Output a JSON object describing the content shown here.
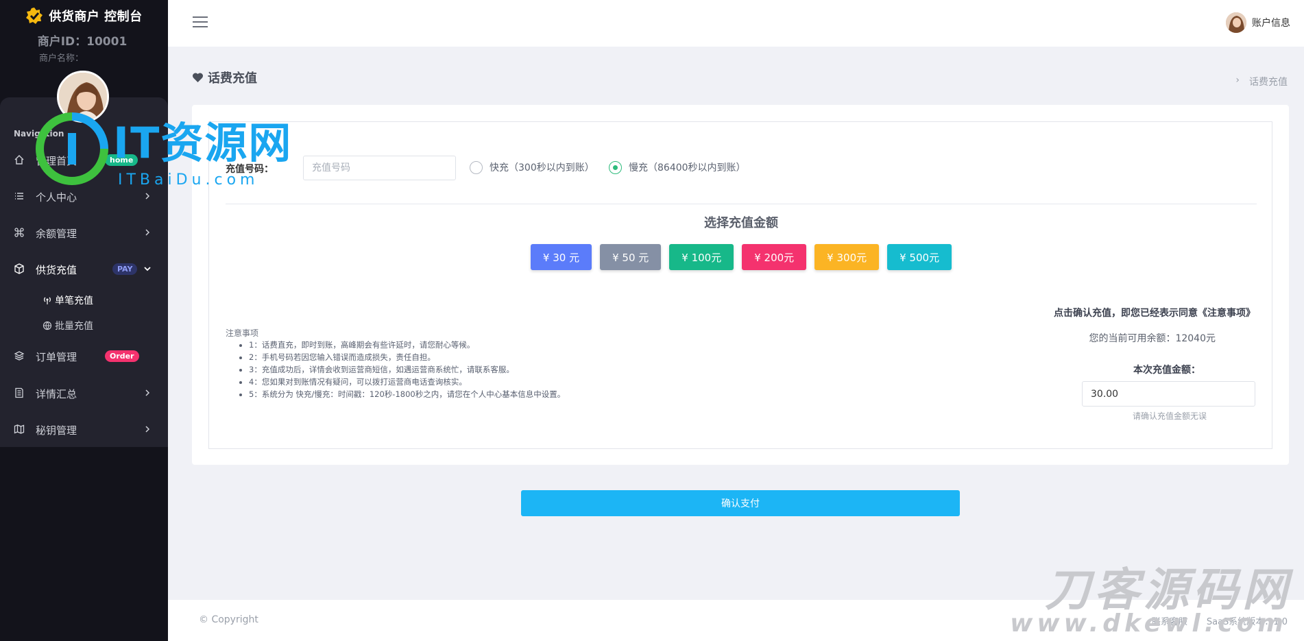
{
  "brand": {
    "title": "供货商户 控制台"
  },
  "merchant": {
    "id_label": "商户ID：10001",
    "name_label": "商户名称："
  },
  "sidebar": {
    "heading": "Navigation",
    "items": [
      {
        "label": "管理首页",
        "icon": "home-icon",
        "badge": "home"
      },
      {
        "label": "个人中心",
        "icon": "list-icon"
      },
      {
        "label": "余额管理",
        "icon": "command-icon"
      },
      {
        "label": "供货充值",
        "icon": "box-icon",
        "badge": "PAY"
      },
      {
        "label": "订单管理",
        "icon": "layers-icon",
        "badge": "Order"
      },
      {
        "label": "详情汇总",
        "icon": "document-icon"
      },
      {
        "label": "秘钥管理",
        "icon": "map-icon"
      }
    ],
    "sub_items": [
      {
        "label": "单笔充值",
        "icon": "broadcast-icon"
      },
      {
        "label": "批量充值",
        "icon": "globe-icon"
      }
    ]
  },
  "header": {
    "account_label": "账户信息"
  },
  "page": {
    "title": "话费充值",
    "breadcrumb": "话费充值"
  },
  "form": {
    "phone_label": "充值号码：",
    "phone_placeholder": "充值号码",
    "radio_fast": "快充（300秒以内到账）",
    "radio_slow": "慢充（86400秒以内到账）",
    "selected_radio": "slow"
  },
  "amount_section": {
    "title": "选择充值金额",
    "buttons": [
      {
        "label": "¥ 30 元",
        "color": "#5b7cfa"
      },
      {
        "label": "¥ 50 元",
        "color": "#8590a5"
      },
      {
        "label": "¥ 100元",
        "color": "#17b889"
      },
      {
        "label": "¥ 200元",
        "color": "#f4326e"
      },
      {
        "label": "¥ 300元",
        "color": "#fbb424"
      },
      {
        "label": "¥ 500元",
        "color": "#16bccf"
      }
    ]
  },
  "notes": {
    "title": "注意事项",
    "items": [
      "1：话费直充，即时到账，高峰期会有些许延时，请您耐心等候。",
      "2：手机号码若因您输入错误而造成损失，责任自担。",
      "3：充值成功后，详情会收到运营商短信，如遇运营商系统忙，请联系客服。",
      "4：您如果对到账情况有疑问，可以拨打运营商电话查询核实。",
      "5：系统分为 快充/慢充：时间戳：120秒-1800秒之内，请您在个人中心基本信息中设置。"
    ]
  },
  "summary": {
    "agree_text": "点击确认充值，即您已经表示同意《注意事项》",
    "balance_text": "您的当前可用余额：12040元",
    "this_amount_label": "本次充值金额：",
    "this_amount_value": "30.00",
    "hint": "请确认充值金额无误"
  },
  "confirm_label": "确认支付",
  "footer": {
    "copyright": "© Copyright",
    "contact": "联系客服",
    "version": "SaaS系统版本：1.0"
  },
  "watermarks": {
    "it_brand": "IT资源网",
    "it_url": "ITBaiDu.com",
    "dk_brand": "刀客源码网",
    "dk_url": "www.dkewl.com"
  },
  "colors": {
    "sidebar_bg": "#13131b",
    "accent": "#1cb5f5",
    "active_radio": "#2dbb7c"
  }
}
